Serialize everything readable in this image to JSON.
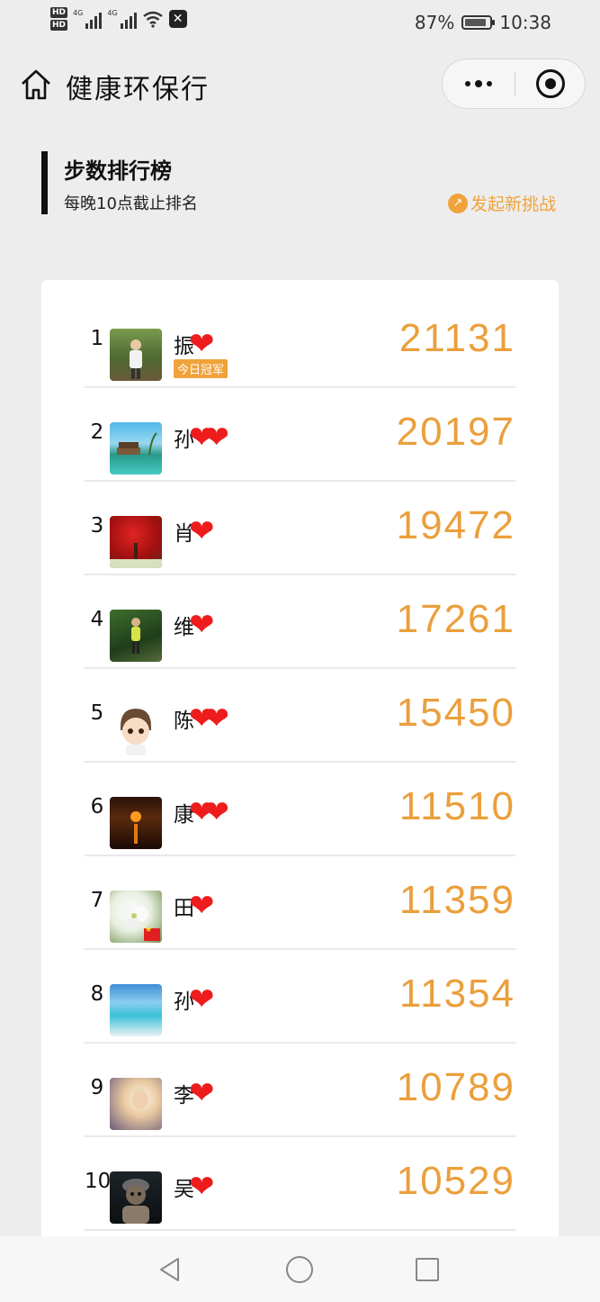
{
  "status_bar": {
    "hd1": "HD",
    "hd2": "HD",
    "net1": "4G",
    "net2": "4G",
    "battery_percent": "87%",
    "battery_level": 0.87,
    "time": "10:38",
    "icons": [
      "signal-icon",
      "wifi-icon",
      "capcut-icon",
      "battery-icon"
    ]
  },
  "nav": {
    "title": "健康环保行",
    "icons": [
      "home-icon",
      "more-icon",
      "close-target-icon"
    ]
  },
  "board": {
    "title": "步数排行榜",
    "subtitle": "每晚10点截止排名",
    "challenge_label": "发起新挑战",
    "challenge_icon": "share-icon",
    "accent_color": "#eb9f3c"
  },
  "rows": [
    {
      "rank": "1",
      "name": "振",
      "hearts": "❤",
      "badge": "今日冠军",
      "steps": "21131"
    },
    {
      "rank": "2",
      "name": "孙",
      "hearts": "❤❤",
      "steps": "20197"
    },
    {
      "rank": "3",
      "name": "肖",
      "hearts": "❤",
      "steps": "19472"
    },
    {
      "rank": "4",
      "name": "维",
      "hearts": "❤",
      "steps": "17261"
    },
    {
      "rank": "5",
      "name": "陈",
      "hearts": "❤❤",
      "steps": "15450"
    },
    {
      "rank": "6",
      "name": "康",
      "hearts": "❤❤",
      "steps": "11510"
    },
    {
      "rank": "7",
      "name": "田",
      "hearts": "❤",
      "steps": "11359"
    },
    {
      "rank": "8",
      "name": "孙",
      "hearts": "❤",
      "steps": "11354"
    },
    {
      "rank": "9",
      "name": "李",
      "hearts": "❤",
      "steps": "10789"
    },
    {
      "rank": "10",
      "name": "吴",
      "hearts": "❤",
      "steps": "10529"
    }
  ],
  "system_nav": {
    "icons": [
      "back-icon",
      "home-circle-icon",
      "recents-icon"
    ]
  }
}
